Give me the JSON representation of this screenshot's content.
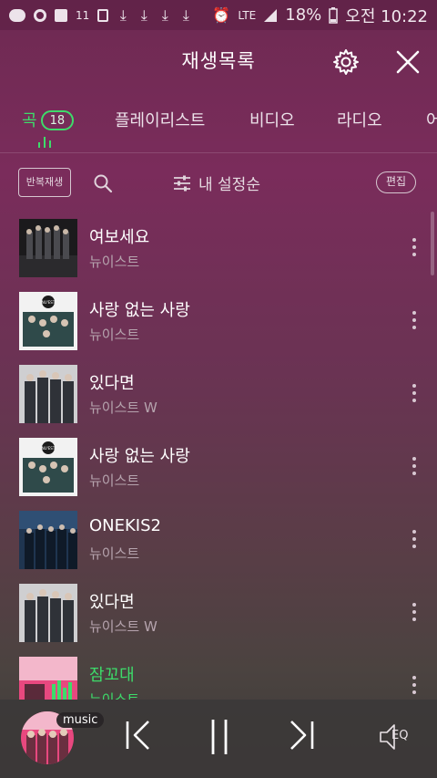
{
  "status_bar": {
    "nfc_label": "11",
    "network": "LTE",
    "battery": "18%",
    "time": "오전 10:22"
  },
  "header": {
    "title": "재생목록"
  },
  "tabs": [
    {
      "label": "곡",
      "count": "18",
      "active": true
    },
    {
      "label": "플레이리스트",
      "active": false
    },
    {
      "label": "비디오",
      "active": false
    },
    {
      "label": "라디오",
      "active": false
    },
    {
      "label": "어",
      "active": false
    }
  ],
  "toolbar": {
    "repeat_label": "반복재생",
    "sort_label": "내 설정순",
    "edit_label": "편집"
  },
  "songs": [
    {
      "title": "여보세요",
      "artist": "뉴이스트",
      "art": "dark"
    },
    {
      "title": "사랑 없는 사랑",
      "artist": "뉴이스트",
      "art": "teal"
    },
    {
      "title": "있다면",
      "artist": "뉴이스트 W",
      "art": "grey"
    },
    {
      "title": "사랑 없는 사랑",
      "artist": "뉴이스트",
      "art": "teal"
    },
    {
      "title": "ONEKIS2",
      "artist": "뉴이스트",
      "art": "blue"
    },
    {
      "title": "있다면",
      "artist": "뉴이스트 W",
      "art": "grey"
    },
    {
      "title": "잠꼬대",
      "artist": "뉴이스트",
      "art": "pink",
      "playing": true
    }
  ],
  "player": {
    "tag": "music",
    "eq_label": "EQ"
  },
  "colors": {
    "accent": "#3ddc6a",
    "bg_top": "#7a2c5b",
    "bg_bottom": "#3c3a38"
  }
}
